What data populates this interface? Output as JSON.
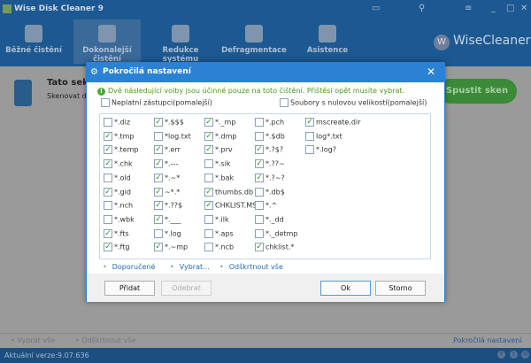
{
  "app": {
    "title": "Wise Disk Cleaner 9",
    "brand": "WiseCleaner",
    "version": "Aktuální verze:9.07.636"
  },
  "nav": [
    {
      "label": "Běžné čistění"
    },
    {
      "label": "Dokonalejší čistění",
      "active": true
    },
    {
      "label": "Redukce systému"
    },
    {
      "label": "Defragmentace"
    },
    {
      "label": "Asistence"
    }
  ],
  "section": {
    "title": "Tato sekce",
    "desc": "Skenovat do",
    "scan_button": "Spustit sken"
  },
  "bottom": {
    "select_all": "Vybrat vše",
    "deselect_all": "Odškrtnout vše",
    "advanced": "Pokročilá nastavení"
  },
  "dialog": {
    "title": "Pokročilá nastavení",
    "note": "Dvě následující volby jsou účinné pouze na toto čištění. Přištěsi opět musíte vybrat.",
    "opt_invalid": {
      "label": "Neplatní zástupci(pomalejší)",
      "checked": false
    },
    "opt_zero": {
      "label": "Soubory s nulovou velikostí(pomalejší)",
      "checked": false
    },
    "columns": [
      [
        {
          "l": "*.diz",
          "c": false
        },
        {
          "l": "*.tmp",
          "c": true
        },
        {
          "l": "*.temp",
          "c": true
        },
        {
          "l": "*.chk",
          "c": true
        },
        {
          "l": "*.old",
          "c": false
        },
        {
          "l": "*.gid",
          "c": true
        },
        {
          "l": "*.nch",
          "c": false
        },
        {
          "l": "*.wbk",
          "c": false
        },
        {
          "l": "*.fts",
          "c": true
        },
        {
          "l": "*.ftg",
          "c": true
        }
      ],
      [
        {
          "l": "*.$$$",
          "c": true
        },
        {
          "l": "*log.txt",
          "c": false
        },
        {
          "l": "*.err",
          "c": true
        },
        {
          "l": "*.---",
          "c": true
        },
        {
          "l": "*.~*",
          "c": true
        },
        {
          "l": "~*.*",
          "c": true
        },
        {
          "l": "*.??$",
          "c": true
        },
        {
          "l": "*.___",
          "c": true
        },
        {
          "l": "*.log",
          "c": false
        },
        {
          "l": "*.~mp",
          "c": true
        }
      ],
      [
        {
          "l": "*._mp",
          "c": true
        },
        {
          "l": "*.dmp",
          "c": true
        },
        {
          "l": "*.prv",
          "c": true
        },
        {
          "l": "*.sik",
          "c": false
        },
        {
          "l": "*.bak",
          "c": false
        },
        {
          "l": "thumbs.db",
          "c": true
        },
        {
          "l": "CHKLIST.MS",
          "c": true
        },
        {
          "l": "*.ilk",
          "c": false
        },
        {
          "l": "*.aps",
          "c": false
        },
        {
          "l": "*.ncb",
          "c": false
        }
      ],
      [
        {
          "l": "*.pch",
          "c": false
        },
        {
          "l": "*.$db",
          "c": false
        },
        {
          "l": "*.?$?",
          "c": true
        },
        {
          "l": "*.??~",
          "c": true
        },
        {
          "l": "*.?~?",
          "c": true
        },
        {
          "l": "*.db$",
          "c": false
        },
        {
          "l": "*.^",
          "c": false
        },
        {
          "l": "*._dd",
          "c": false
        },
        {
          "l": "*._detmp",
          "c": false
        },
        {
          "l": "chklist.*",
          "c": true
        }
      ],
      [
        {
          "l": "mscreate.dir",
          "c": true
        },
        {
          "l": "log*.txt",
          "c": false
        },
        {
          "l": "*.log?",
          "c": false
        }
      ]
    ],
    "links": {
      "recommended": "Doporučené",
      "select": "Vybrat...",
      "deselect_all": "Odškrtnout vše"
    },
    "buttons": {
      "add": "Přidat",
      "remove": "Odebrat",
      "ok": "Ok",
      "cancel": "Storno"
    }
  }
}
